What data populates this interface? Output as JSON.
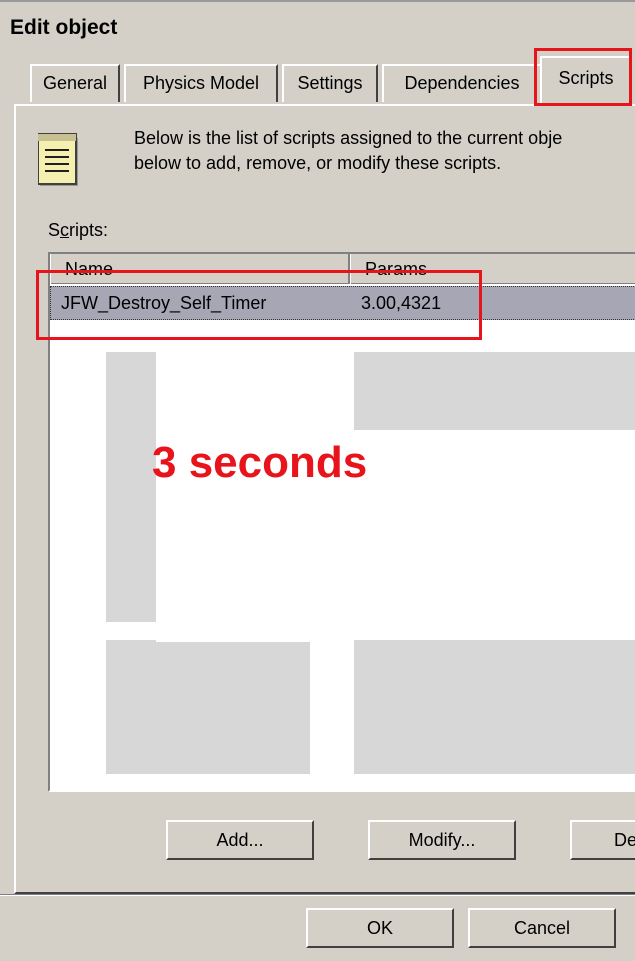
{
  "window": {
    "title": "Edit object"
  },
  "tabs": [
    {
      "label": "General"
    },
    {
      "label": "Physics Model"
    },
    {
      "label": "Settings"
    },
    {
      "label": "Dependencies"
    },
    {
      "label": "Scripts",
      "active": true
    }
  ],
  "description": {
    "line1": "Below is the list of scripts assigned to the current obje",
    "line2": "below to add, remove, or modify these scripts."
  },
  "scripts_list": {
    "label_prefix": "S",
    "label_underlined": "c",
    "label_suffix": "ripts:",
    "columns": [
      "Name",
      "Params"
    ],
    "rows": [
      {
        "name": "JFW_Destroy_Self_Timer",
        "params": "3.00,4321"
      }
    ]
  },
  "annotation": {
    "text": "3 seconds",
    "color": "#e8141c"
  },
  "list_buttons": {
    "add": "Add...",
    "modify": "Modify...",
    "delete": "De"
  },
  "dialog_buttons": {
    "ok": "OK",
    "cancel": "Cancel"
  },
  "icons": {
    "script_icon": "notepad-icon"
  }
}
